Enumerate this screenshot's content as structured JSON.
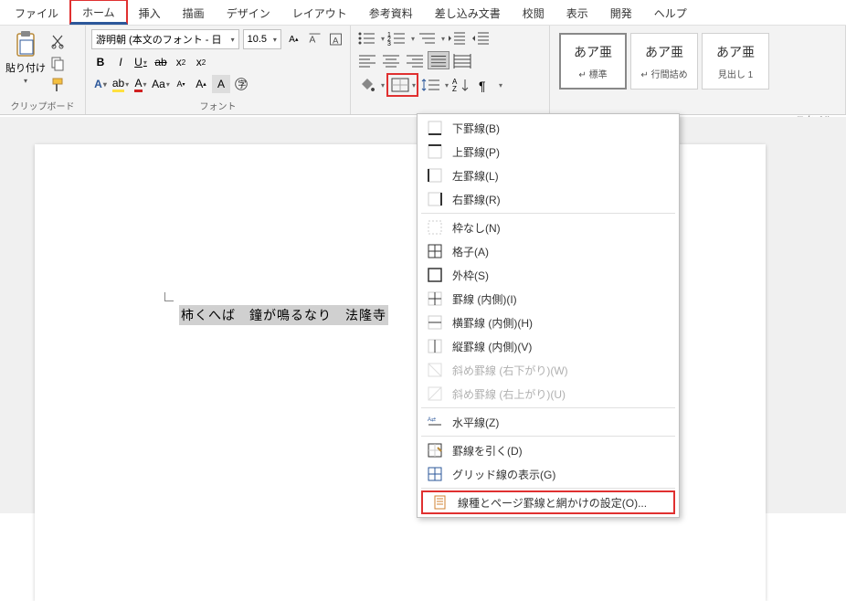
{
  "tabs": [
    "ファイル",
    "ホーム",
    "挿入",
    "描画",
    "デザイン",
    "レイアウト",
    "参考資料",
    "差し込み文書",
    "校閲",
    "表示",
    "開発",
    "ヘルプ"
  ],
  "active_tab_index": 1,
  "clipboard": {
    "paste": "貼り付け",
    "group": "クリップボード"
  },
  "font": {
    "name": "游明朝 (本文のフォント - 日",
    "size": "10.5",
    "group": "フォント"
  },
  "styles": {
    "group": "スタイル",
    "items": [
      {
        "sample": "あア亜",
        "name": "↵ 標準"
      },
      {
        "sample": "あア亜",
        "name": "↵ 行間詰め"
      },
      {
        "sample": "あア亜",
        "name": "見出し 1"
      }
    ]
  },
  "document_text": "柿くへば　鐘が鳴るなり　法隆寺",
  "border_menu": [
    {
      "icon": "bottom",
      "label": "下罫線(B)"
    },
    {
      "icon": "top",
      "label": "上罫線(P)"
    },
    {
      "icon": "left",
      "label": "左罫線(L)"
    },
    {
      "icon": "right",
      "label": "右罫線(R)"
    },
    {
      "icon": "none",
      "label": "枠なし(N)"
    },
    {
      "icon": "grid",
      "label": "格子(A)"
    },
    {
      "icon": "outside",
      "label": "外枠(S)"
    },
    {
      "icon": "inside",
      "label": "罫線 (内側)(I)"
    },
    {
      "icon": "hinside",
      "label": "横罫線 (内側)(H)"
    },
    {
      "icon": "vinside",
      "label": "縦罫線 (内側)(V)"
    },
    {
      "icon": "diagdown",
      "label": "斜め罫線 (右下がり)(W)",
      "disabled": true
    },
    {
      "icon": "diagup",
      "label": "斜め罫線 (右上がり)(U)",
      "disabled": true
    },
    {
      "icon": "hline",
      "label": "水平線(Z)"
    },
    {
      "icon": "draw",
      "label": "罫線を引く(D)"
    },
    {
      "icon": "gridshow",
      "label": "グリッド線の表示(G)"
    },
    {
      "icon": "settings",
      "label": "線種とページ罫線と網かけの設定(O)...",
      "boxed": true
    }
  ]
}
